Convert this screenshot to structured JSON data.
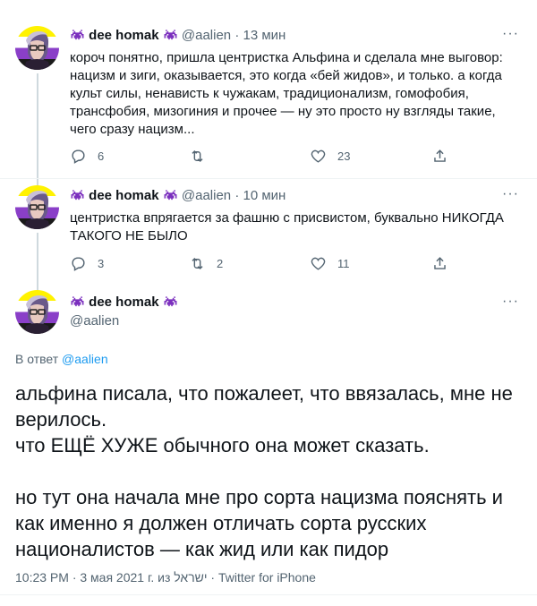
{
  "tweets": [
    {
      "name": "dee homak",
      "handle": "@aalien",
      "dot": "·",
      "time": "13 мин",
      "text": "короч понятно, пришла центристка Альфина и сделала мне выговор: нацизм и зиги, оказывается, это когда «бей жидов», и только. а когда культ силы, ненависть к чужакам, традиционализм, гомофобия, трансфобия, мизогиния и прочее — ну это просто ну взгляды такие, чего сразу нацизм...",
      "replies": "6",
      "retweets": "",
      "likes": "23"
    },
    {
      "name": "dee homak",
      "handle": "@aalien",
      "dot": "·",
      "time": "10 мин",
      "text": "центристка впрягается за фашню с присвистом, буквально НИКОГДА ТАКОГО НЕ БЫЛО",
      "replies": "3",
      "retweets": "2",
      "likes": "11"
    }
  ],
  "main": {
    "name": "dee homak",
    "handle": "@aalien",
    "reply_prefix": "В ответ",
    "reply_mention": "@aalien",
    "lines": [
      "альфина писала, что пожалеет, что ввязалась, мне не верилось.",
      "что ЕЩЁ ХУЖЕ обычного она может сказать.",
      "",
      "но тут она начала мне про сорта нацизма пояснять и как именно я должен отличать сорта русских националистов — как жид или как пидор"
    ],
    "meta": "10:23 PM · 3 мая 2021 г. из ישראל · Twitter for iPhone"
  },
  "icons": {
    "emoji": "alien-monster-icon",
    "more": "more-icon",
    "reply": "reply-icon",
    "retweet": "retweet-icon",
    "like": "like-icon",
    "share": "share-icon"
  },
  "colors": {
    "accent": "#1d9bf0",
    "secondary_text": "#536471",
    "divider": "#eff3f4",
    "emoji_purple": "#7b2fbe"
  }
}
